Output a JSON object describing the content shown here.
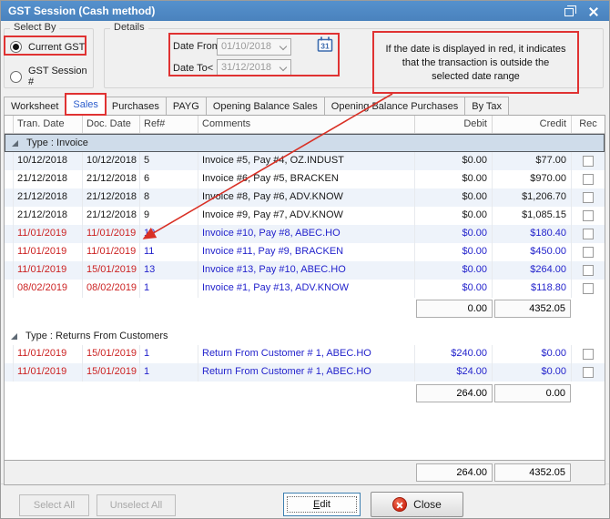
{
  "window": {
    "title": "GST Session (Cash method)"
  },
  "select_by": {
    "label": "Select By",
    "options": [
      {
        "label": "Current GST",
        "selected": true,
        "highlighted": true
      },
      {
        "label": "GST Session #",
        "selected": false
      }
    ]
  },
  "details": {
    "label": "Details",
    "date_from_label": "Date From>",
    "date_from_value": "01/10/2018",
    "date_to_label": "Date To<",
    "date_to_value": "31/12/2018",
    "calendar_day": "31"
  },
  "annotation": {
    "text": "If the date is displayed in red, it indicates that the transaction is outside the selected date range"
  },
  "tabs": [
    {
      "label": "Worksheet"
    },
    {
      "label": "Sales",
      "selected": true,
      "highlighted": true
    },
    {
      "label": "Purchases"
    },
    {
      "label": "PAYG"
    },
    {
      "label": "Opening Balance Sales"
    },
    {
      "label": "Opening Balance Purchases"
    },
    {
      "label": "By Tax"
    }
  ],
  "grid": {
    "columns": [
      "Tran. Date",
      "Doc. Date",
      "Ref#",
      "Comments",
      "Debit",
      "Credit",
      "Rec"
    ],
    "groups": [
      {
        "label": "Type : Invoice",
        "rows": [
          {
            "tran": "10/12/2018",
            "doc": "10/12/2018",
            "ref": "5",
            "comments": "Invoice #5, Pay #4, OZ.INDUST",
            "debit": "$0.00",
            "credit": "$77.00",
            "out_of_range": false
          },
          {
            "tran": "21/12/2018",
            "doc": "21/12/2018",
            "ref": "6",
            "comments": "Invoice #6, Pay #5, BRACKEN",
            "debit": "$0.00",
            "credit": "$970.00",
            "out_of_range": false
          },
          {
            "tran": "21/12/2018",
            "doc": "21/12/2018",
            "ref": "8",
            "comments": "Invoice #8, Pay #6, ADV.KNOW",
            "debit": "$0.00",
            "credit": "$1,206.70",
            "out_of_range": false
          },
          {
            "tran": "21/12/2018",
            "doc": "21/12/2018",
            "ref": "9",
            "comments": "Invoice #9, Pay #7, ADV.KNOW",
            "debit": "$0.00",
            "credit": "$1,085.15",
            "out_of_range": false
          },
          {
            "tran": "11/01/2019",
            "doc": "11/01/2019",
            "ref": "10",
            "comments": "Invoice #10, Pay #8, ABEC.HO",
            "debit": "$0.00",
            "credit": "$180.40",
            "out_of_range": true
          },
          {
            "tran": "11/01/2019",
            "doc": "11/01/2019",
            "ref": "11",
            "comments": "Invoice #11, Pay #9, BRACKEN",
            "debit": "$0.00",
            "credit": "$450.00",
            "out_of_range": true
          },
          {
            "tran": "11/01/2019",
            "doc": "15/01/2019",
            "ref": "13",
            "comments": "Invoice #13, Pay #10, ABEC.HO",
            "debit": "$0.00",
            "credit": "$264.00",
            "out_of_range": true
          },
          {
            "tran": "08/02/2019",
            "doc": "08/02/2019",
            "ref": "1",
            "comments": "Invoice #1, Pay #13, ADV.KNOW",
            "debit": "$0.00",
            "credit": "$118.80",
            "out_of_range": true
          }
        ],
        "subtotal": {
          "debit": "0.00",
          "credit": "4352.05"
        }
      },
      {
        "label": "Type : Returns From Customers",
        "rows": [
          {
            "tran": "11/01/2019",
            "doc": "15/01/2019",
            "ref": "1",
            "comments": "Return From Customer # 1, ABEC.HO",
            "debit": "$240.00",
            "credit": "$0.00",
            "out_of_range": true
          },
          {
            "tran": "11/01/2019",
            "doc": "15/01/2019",
            "ref": "1",
            "comments": "Return From Customer # 1, ABEC.HO",
            "debit": "$24.00",
            "credit": "$0.00",
            "out_of_range": true
          }
        ],
        "subtotal": {
          "debit": "264.00",
          "credit": "0.00"
        }
      }
    ],
    "total": {
      "debit": "264.00",
      "credit": "4352.05"
    }
  },
  "buttons": {
    "select_all": "Select All",
    "unselect_all": "Unselect All",
    "edit": "Edit",
    "close": "Close"
  },
  "colors": {
    "titlebar": "#4d87c4",
    "annotation_red": "#e03232",
    "out_of_range_date": "#cc2222",
    "out_of_range_value": "#2323cc",
    "selected_tab_text": "#2b5ccc",
    "group_header_bg": "#cfdcea",
    "alt_row_bg": "#eef3fa",
    "close_icon_red": "#d22c18"
  }
}
